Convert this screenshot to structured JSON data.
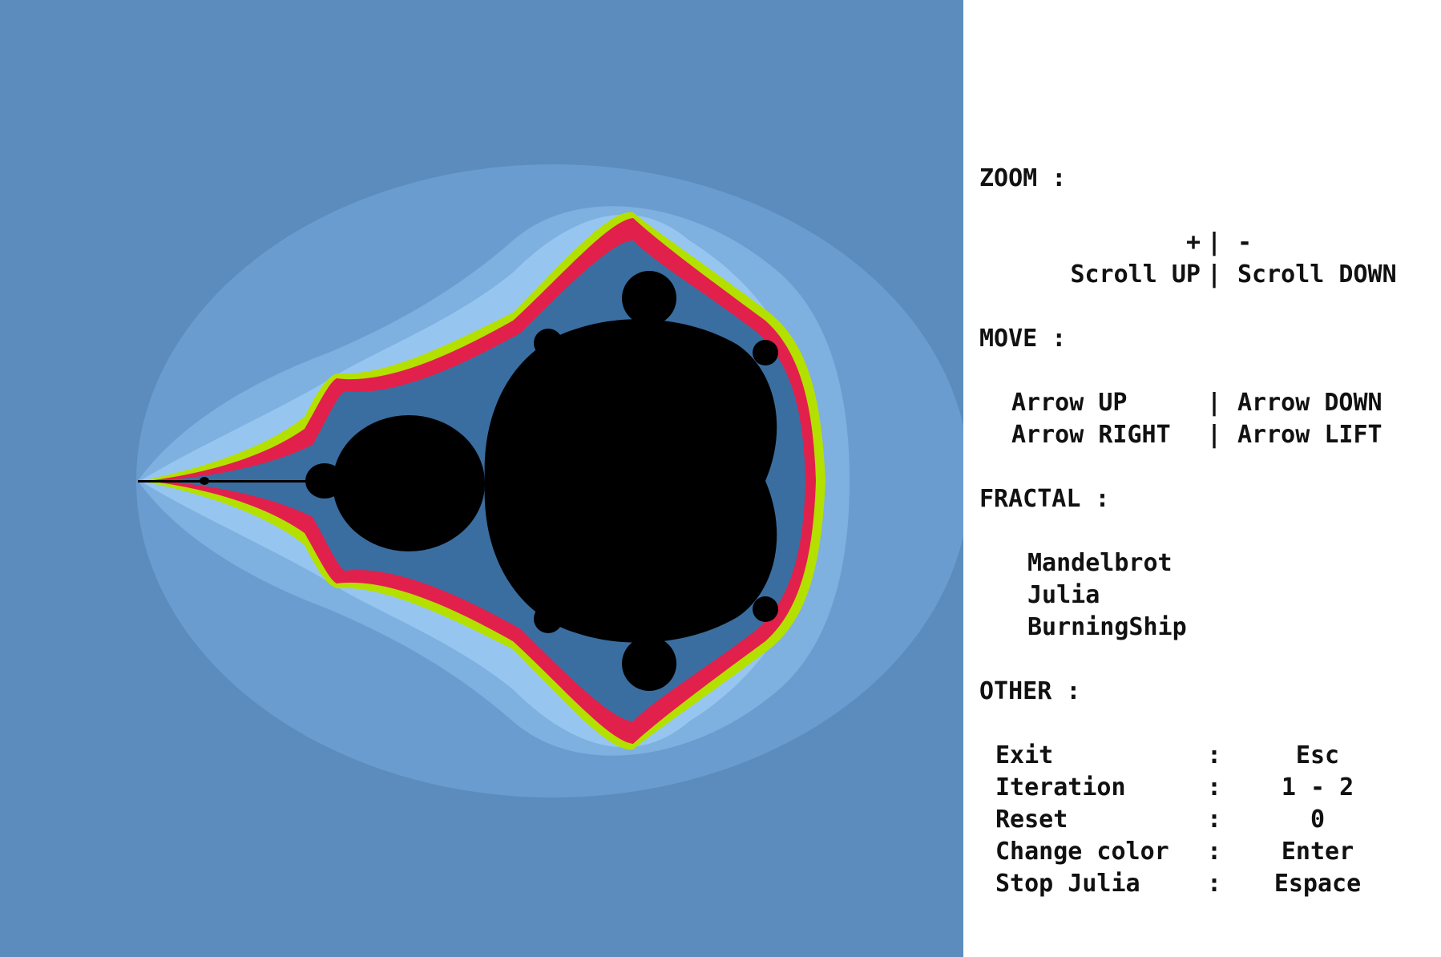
{
  "colors": {
    "background": "#5b8cbd",
    "halo_outer": "#6b9ccf",
    "halo_mid": "#7eb0e0",
    "halo_inner": "#96c6f0",
    "band_yellow": "#b4e000",
    "band_red": "#e2204c",
    "band_blue": "#3a6ea0",
    "set_black": "#000000",
    "panel_bg": "#ffffff",
    "text": "#111111"
  },
  "help": {
    "zoom": {
      "title": "ZOOM :",
      "plus": "+",
      "minus": "-",
      "scroll_up": "Scroll UP",
      "scroll_down": "Scroll DOWN",
      "sep": "|"
    },
    "move": {
      "title": "MOVE :",
      "up": "Arrow UP",
      "down": "Arrow DOWN",
      "right": "Arrow RIGHT",
      "left": "Arrow LIFT",
      "sep": "|"
    },
    "fractal": {
      "title": "FRACTAL :",
      "items": [
        "Mandelbrot",
        "Julia",
        "BurningShip"
      ]
    },
    "other": {
      "title": "OTHER :",
      "colon": ":",
      "rows": [
        {
          "label": "Exit",
          "key": "Esc"
        },
        {
          "label": "Iteration",
          "key": "1 - 2"
        },
        {
          "label": "Reset",
          "key": "0"
        },
        {
          "label": "Change color",
          "key": "Enter"
        },
        {
          "label": "Stop Julia",
          "key": "Espace"
        }
      ]
    }
  }
}
